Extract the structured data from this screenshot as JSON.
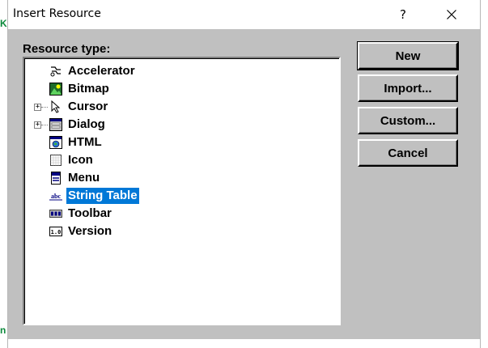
{
  "background": {
    "fragment_top": "KE",
    "fragment_bottom": "n"
  },
  "window": {
    "title": "Insert Resource",
    "help_label": "?"
  },
  "resource_type_label": "Resource type:",
  "resources": [
    {
      "label": "Accelerator",
      "icon": "accelerator-icon",
      "expandable": false,
      "selected": false
    },
    {
      "label": "Bitmap",
      "icon": "bitmap-icon",
      "expandable": false,
      "selected": false
    },
    {
      "label": "Cursor",
      "icon": "cursor-icon",
      "expandable": true,
      "selected": false
    },
    {
      "label": "Dialog",
      "icon": "dialog-icon",
      "expandable": true,
      "selected": false
    },
    {
      "label": "HTML",
      "icon": "html-icon",
      "expandable": false,
      "selected": false
    },
    {
      "label": "Icon",
      "icon": "icon-resource-icon",
      "expandable": false,
      "selected": false
    },
    {
      "label": "Menu",
      "icon": "menu-icon",
      "expandable": false,
      "selected": false
    },
    {
      "label": "String Table",
      "icon": "string-table-icon",
      "expandable": false,
      "selected": true
    },
    {
      "label": "Toolbar",
      "icon": "toolbar-icon",
      "expandable": false,
      "selected": false
    },
    {
      "label": "Version",
      "icon": "version-icon",
      "expandable": false,
      "selected": false
    }
  ],
  "buttons": {
    "new": "New",
    "import": "Import...",
    "custom": "Custom...",
    "cancel": "Cancel"
  },
  "colors": {
    "selection": "#0078d7",
    "dialog_face": "#c0c0c0",
    "background_text": "#0b8a3b"
  }
}
